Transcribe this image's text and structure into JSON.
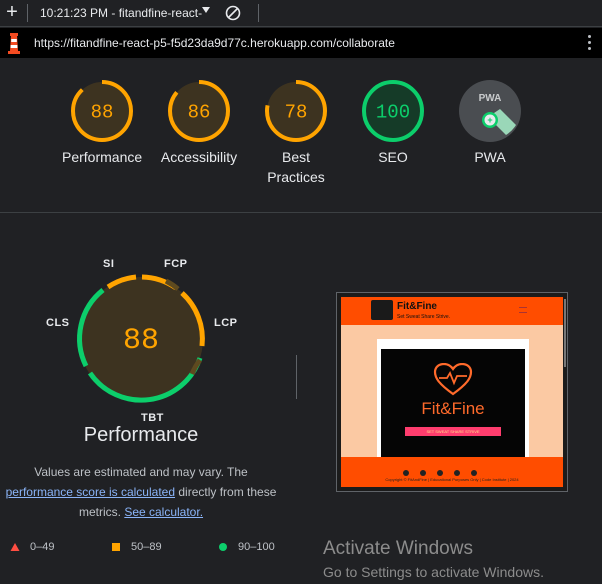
{
  "window": {
    "title": "10:21:23 PM - fitandfine-react-",
    "url": "https://fitandfine-react-p5-f5d23da9d77c.herokuapp.com/collaborate"
  },
  "categories": [
    {
      "label": "Performance",
      "score": "88",
      "value": 88,
      "status": "average",
      "color": "#ffa400"
    },
    {
      "label": "Accessibility",
      "score": "86",
      "value": 86,
      "status": "average",
      "color": "#ffa400"
    },
    {
      "label": "Best Practices",
      "score": "78",
      "value": 78,
      "status": "average",
      "color": "#ffa400"
    },
    {
      "label": "SEO",
      "score": "100",
      "value": 100,
      "status": "pass",
      "color": "#0cce6b"
    },
    {
      "label": "PWA",
      "score": "PWA",
      "status": "n/a",
      "color": "#5f6368"
    }
  ],
  "performance": {
    "title": "Performance",
    "score": "88",
    "metrics": [
      "SI",
      "FCP",
      "LCP",
      "TBT",
      "CLS"
    ]
  },
  "description": {
    "text1": "Values are estimated and may vary. The",
    "link1": "performance score is calculated",
    "text2": "directly from these",
    "text3": "metrics.",
    "link2": "See calculator."
  },
  "legend": [
    {
      "range": "0–49",
      "shape": "triangle",
      "color": "#ff4e42"
    },
    {
      "range": "50–89",
      "shape": "square",
      "color": "#ffa400"
    },
    {
      "range": "90–100",
      "shape": "circle",
      "color": "#0cce6b"
    }
  ],
  "screenshot": {
    "brand": "Fit&Fine",
    "tagline": "Set Sweat Share Strive.",
    "hero_name": "Fit&Fine",
    "ribbon": "SET SWEAT SHARE STRIVE",
    "footer": "Copyright © FitAndFine | Educational Purposes Only | Code Institute | 2024"
  },
  "watermark": {
    "title": "Activate Windows",
    "subtitle": "Go to Settings to activate Windows."
  }
}
